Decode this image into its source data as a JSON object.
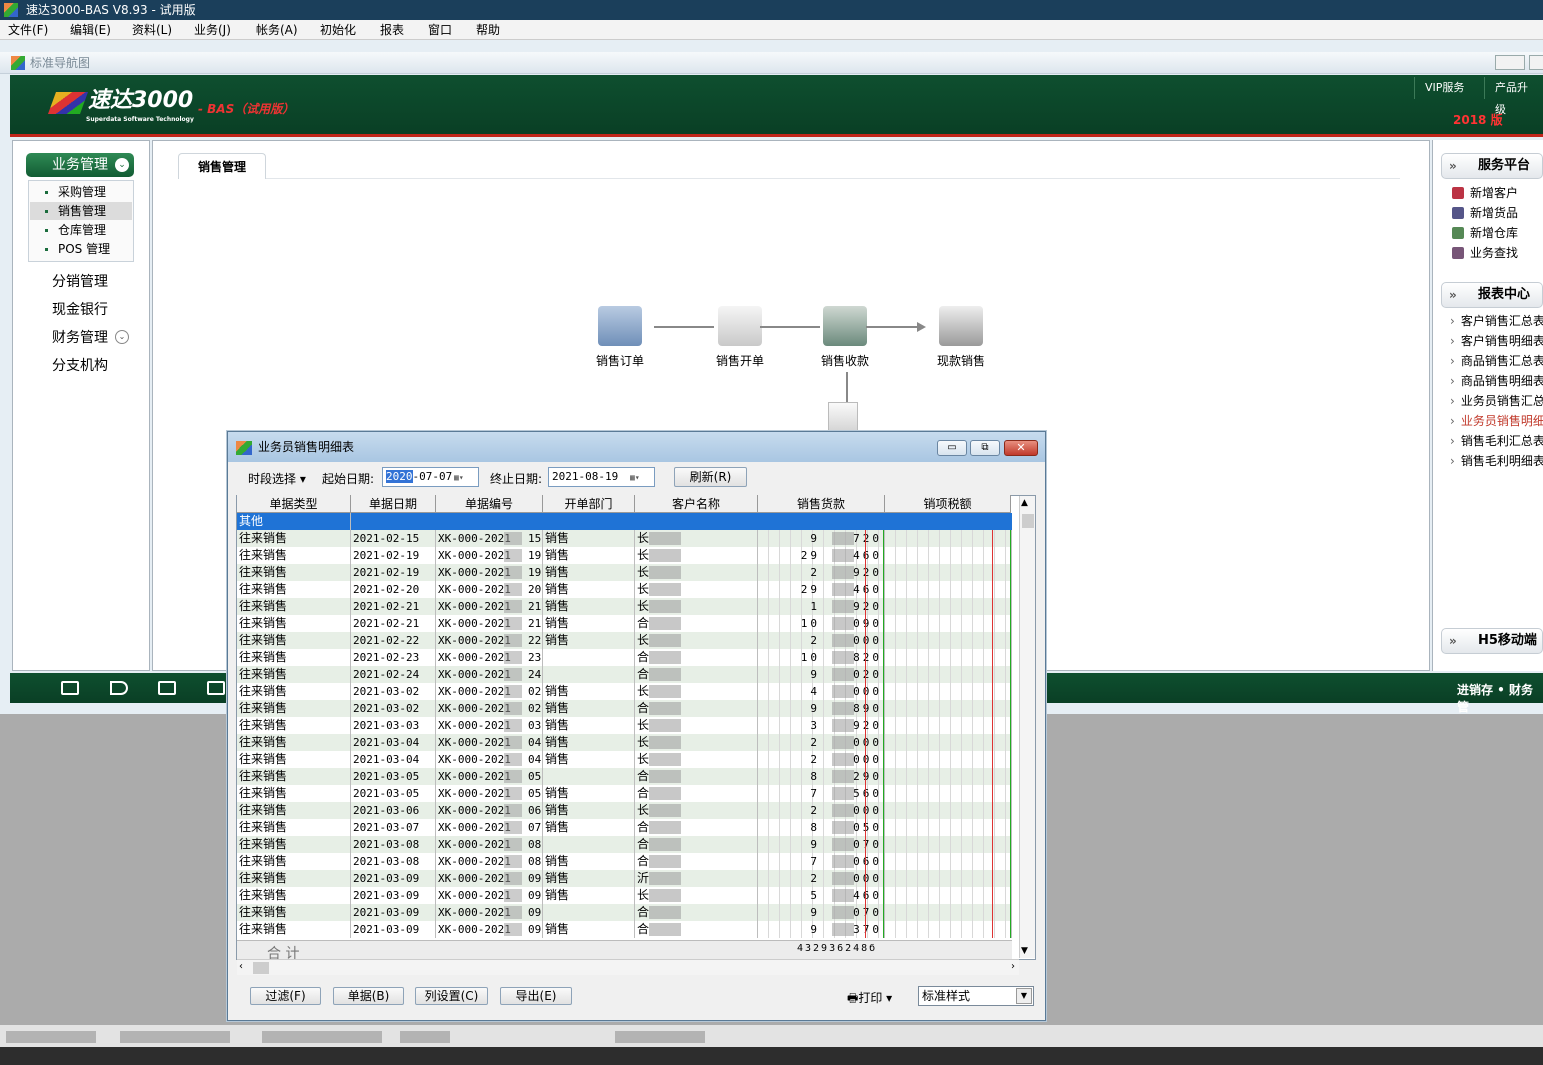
{
  "app": {
    "title": "速达3000-BAS V8.93 - 试用版"
  },
  "menubar": [
    "文件(F)",
    "编辑(E)",
    "资料(L)",
    "业务(J)",
    "帐务(A)",
    "初始化",
    "报表",
    "窗口",
    "帮助"
  ],
  "nav_strip": {
    "title": "标准导航图"
  },
  "banner": {
    "logo_text": "速达3000",
    "logo_suffix": "- BAS（试用版）",
    "logo_sub": "Superdata Software Technology",
    "vip_label": "VIP服务",
    "upgrade_label": "产品升级",
    "year_label": "2018 版"
  },
  "sidebar": {
    "section_title": "业务管理",
    "sub_items": [
      "采购管理",
      "销售管理",
      "仓库管理",
      "POS 管理"
    ],
    "selected_sub": "销售管理",
    "main_items": [
      "分销管理",
      "现金银行",
      "财务管理",
      "分支机构"
    ]
  },
  "center": {
    "tab_label": "销售管理",
    "flow": [
      "销售订单",
      "销售开单",
      "销售收款",
      "现款销售"
    ]
  },
  "right_panel": {
    "service_title": "服务平台",
    "service_items": [
      "新增客户",
      "新增货品",
      "新增仓库",
      "业务查找"
    ],
    "report_title": "报表中心",
    "report_items": [
      "客户销售汇总表",
      "客户销售明细表",
      "商品销售汇总表",
      "商品销售明细表",
      "业务员销售汇总表",
      "业务员销售明细表",
      "销售毛利汇总表",
      "销售毛利明细表"
    ],
    "mobile_title": "H5移动端"
  },
  "bottom_bar": {
    "text": "进销存 • 财务管"
  },
  "dialog": {
    "title": "业务员销售明细表",
    "period_label": "时段选择",
    "start_label": "起始日期:",
    "start_date_year": "2020",
    "start_date_rest": "-07-07",
    "end_label": "终止日期:",
    "end_date": "2021-08-19",
    "refresh_label": "刷新(R)",
    "columns": [
      "单据类型",
      "单据日期",
      "单据编号",
      "开单部门",
      "客户名称",
      "销售货款",
      "销项税额"
    ],
    "first_row": "其他",
    "rows": [
      {
        "type": "往来销售",
        "date": "2021-02-15",
        "no_prefix": "XK-000-2021",
        "no_suffix": "15",
        "dept": "销售",
        "cust": "长",
        "amt_l": "9",
        "amt_r": "720"
      },
      {
        "type": "往来销售",
        "date": "2021-02-19",
        "no_prefix": "XK-000-2021",
        "no_suffix": "19",
        "dept": "销售",
        "cust": "长",
        "amt_l": "29",
        "amt_r": "460"
      },
      {
        "type": "往来销售",
        "date": "2021-02-19",
        "no_prefix": "XK-000-2021",
        "no_suffix": "19",
        "dept": "销售",
        "cust": "长",
        "amt_l": "2",
        "amt_r": "920"
      },
      {
        "type": "往来销售",
        "date": "2021-02-20",
        "no_prefix": "XK-000-2021",
        "no_suffix": "20",
        "dept": "销售",
        "cust": "长",
        "amt_l": "29",
        "amt_r": "460"
      },
      {
        "type": "往来销售",
        "date": "2021-02-21",
        "no_prefix": "XK-000-2021",
        "no_suffix": "21",
        "dept": "销售",
        "cust": "长",
        "amt_l": "1",
        "amt_r": "920"
      },
      {
        "type": "往来销售",
        "date": "2021-02-21",
        "no_prefix": "XK-000-2021",
        "no_suffix": "21",
        "dept": "销售",
        "cust": "合",
        "amt_l": "10",
        "amt_r": "090"
      },
      {
        "type": "往来销售",
        "date": "2021-02-22",
        "no_prefix": "XK-000-2021",
        "no_suffix": "22",
        "dept": "销售",
        "cust": "长",
        "amt_l": "2",
        "amt_r": "000"
      },
      {
        "type": "往来销售",
        "date": "2021-02-23",
        "no_prefix": "XK-000-2021",
        "no_suffix": "23",
        "dept": "",
        "cust": "合",
        "amt_l": "10",
        "amt_r": "820"
      },
      {
        "type": "往来销售",
        "date": "2021-02-24",
        "no_prefix": "XK-000-2021",
        "no_suffix": "24",
        "dept": "",
        "cust": "合",
        "amt_l": "9",
        "amt_r": "020"
      },
      {
        "type": "往来销售",
        "date": "2021-03-02",
        "no_prefix": "XK-000-2021",
        "no_suffix": "02",
        "dept": "销售",
        "cust": "长",
        "amt_l": "4",
        "amt_r": "000"
      },
      {
        "type": "往来销售",
        "date": "2021-03-02",
        "no_prefix": "XK-000-2021",
        "no_suffix": "02",
        "dept": "销售",
        "cust": "合",
        "amt_l": "9",
        "amt_r": "890"
      },
      {
        "type": "往来销售",
        "date": "2021-03-03",
        "no_prefix": "XK-000-2021",
        "no_suffix": "03",
        "dept": "销售",
        "cust": "长",
        "amt_l": "3",
        "amt_r": "920"
      },
      {
        "type": "往来销售",
        "date": "2021-03-04",
        "no_prefix": "XK-000-2021",
        "no_suffix": "04",
        "dept": "销售",
        "cust": "长",
        "amt_l": "2",
        "amt_r": "000"
      },
      {
        "type": "往来销售",
        "date": "2021-03-04",
        "no_prefix": "XK-000-2021",
        "no_suffix": "04",
        "dept": "销售",
        "cust": "长",
        "amt_l": "2",
        "amt_r": "000"
      },
      {
        "type": "往来销售",
        "date": "2021-03-05",
        "no_prefix": "XK-000-2021",
        "no_suffix": "05",
        "dept": "",
        "cust": "合",
        "amt_l": "8",
        "amt_r": "290"
      },
      {
        "type": "往来销售",
        "date": "2021-03-05",
        "no_prefix": "XK-000-2021",
        "no_suffix": "05",
        "dept": "销售",
        "cust": "合",
        "amt_l": "7",
        "amt_r": "560"
      },
      {
        "type": "往来销售",
        "date": "2021-03-06",
        "no_prefix": "XK-000-2021",
        "no_suffix": "06",
        "dept": "销售",
        "cust": "长",
        "amt_l": "2",
        "amt_r": "000"
      },
      {
        "type": "往来销售",
        "date": "2021-03-07",
        "no_prefix": "XK-000-2021",
        "no_suffix": "07",
        "dept": "销售",
        "cust": "合",
        "amt_l": "8",
        "amt_r": "050"
      },
      {
        "type": "往来销售",
        "date": "2021-03-08",
        "no_prefix": "XK-000-2021",
        "no_suffix": "08",
        "dept": "",
        "cust": "合",
        "amt_l": "9",
        "amt_r": "070"
      },
      {
        "type": "往来销售",
        "date": "2021-03-08",
        "no_prefix": "XK-000-2021",
        "no_suffix": "08",
        "dept": "销售",
        "cust": "合",
        "amt_l": "7",
        "amt_r": "060"
      },
      {
        "type": "往来销售",
        "date": "2021-03-09",
        "no_prefix": "XK-000-2021",
        "no_suffix": "09",
        "dept": "销售",
        "cust": "沂",
        "amt_l": "2",
        "amt_r": "000"
      },
      {
        "type": "往来销售",
        "date": "2021-03-09",
        "no_prefix": "XK-000-2021",
        "no_suffix": "09",
        "dept": "销售",
        "cust": "长",
        "amt_l": "5",
        "amt_r": "460"
      },
      {
        "type": "往来销售",
        "date": "2021-03-09",
        "no_prefix": "XK-000-2021",
        "no_suffix": "09",
        "dept": "",
        "cust": "合",
        "amt_l": "9",
        "amt_r": "070"
      },
      {
        "type": "往来销售",
        "date": "2021-03-09",
        "no_prefix": "XK-000-2021",
        "no_suffix": "09",
        "dept": "销售",
        "cust": "合",
        "amt_l": "9",
        "amt_r": "370"
      }
    ],
    "total_label": "合  计",
    "total_amount": "432936248б",
    "buttons": {
      "filter": "过滤(F)",
      "voucher": "单据(B)",
      "columns": "列设置(C)",
      "export": "导出(E)"
    },
    "print_label": "打印",
    "style_value": "标准样式"
  }
}
